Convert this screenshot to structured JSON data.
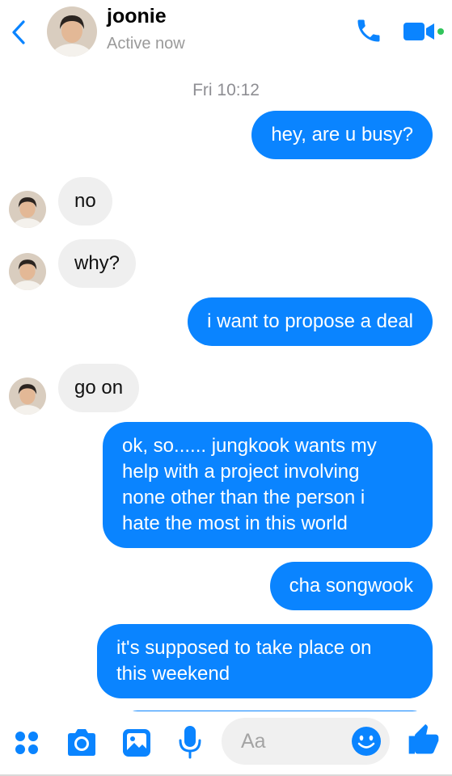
{
  "header": {
    "contact_name": "joonie",
    "status": "Active now"
  },
  "colors": {
    "accent": "#0a84ff",
    "incoming_bubble": "#efefef",
    "online_dot": "#31c45b"
  },
  "conversation": {
    "timestamp": "Fri 10:12",
    "messages": [
      {
        "direction": "out",
        "text": "hey, are u busy?"
      },
      {
        "direction": "in",
        "text": "no"
      },
      {
        "direction": "in",
        "text": "why?"
      },
      {
        "direction": "out",
        "text": "i want to propose a deal"
      },
      {
        "direction": "in",
        "text": "go on"
      },
      {
        "direction": "out",
        "text": "ok, so...... jungkook wants my\nhelp with a project involving\nnone other than the person i\nhate the most in this world"
      },
      {
        "direction": "out",
        "text": "cha songwook"
      },
      {
        "direction": "out",
        "text": "it's supposed to take place on\nthis weekend"
      }
    ]
  },
  "composer": {
    "placeholder": "Aa",
    "icons": [
      "apps-icon",
      "camera-icon",
      "gallery-icon",
      "microphone-icon",
      "emoji-icon",
      "thumbs-up-icon"
    ]
  }
}
